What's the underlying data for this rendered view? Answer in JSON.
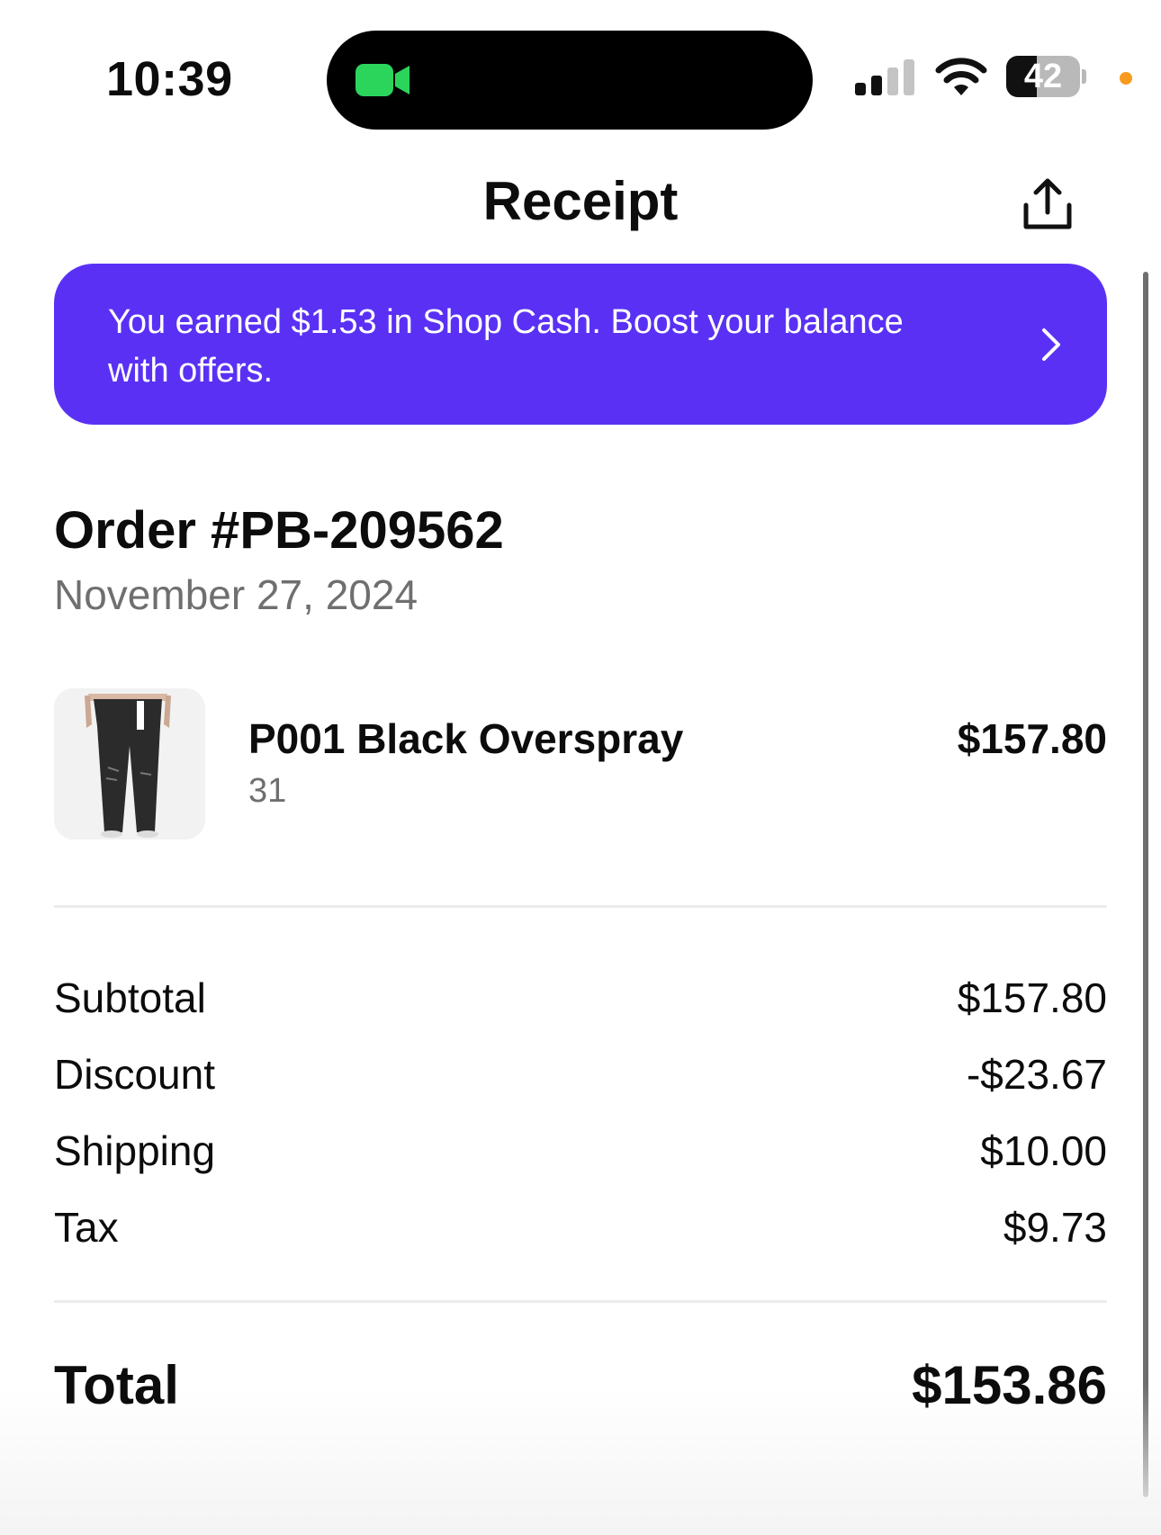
{
  "status_bar": {
    "time": "10:39",
    "battery_level": "42",
    "battery_fraction": 0.42,
    "camera_indicator_color": "#2bd55c",
    "privacy_dot_color": "#f79a1e"
  },
  "header": {
    "title": "Receipt",
    "share_icon": "share-icon"
  },
  "banner": {
    "text": "You earned $1.53 in Shop Cash. Boost your balance with offers.",
    "background": "#5a31f4",
    "chevron_icon": "chevron-right-icon"
  },
  "order": {
    "number": "Order #PB-209562",
    "date": "November 27, 2024"
  },
  "items": [
    {
      "name": "P001 Black Overspray",
      "variant": "31",
      "price": "$157.80",
      "thumbnail_icon": "jeans-product-image"
    }
  ],
  "summary": {
    "subtotal_label": "Subtotal",
    "subtotal_value": "$157.80",
    "discount_label": "Discount",
    "discount_value": "-$23.67",
    "shipping_label": "Shipping",
    "shipping_value": "$10.00",
    "tax_label": "Tax",
    "tax_value": "$9.73"
  },
  "total": {
    "label": "Total",
    "value": "$153.86"
  }
}
